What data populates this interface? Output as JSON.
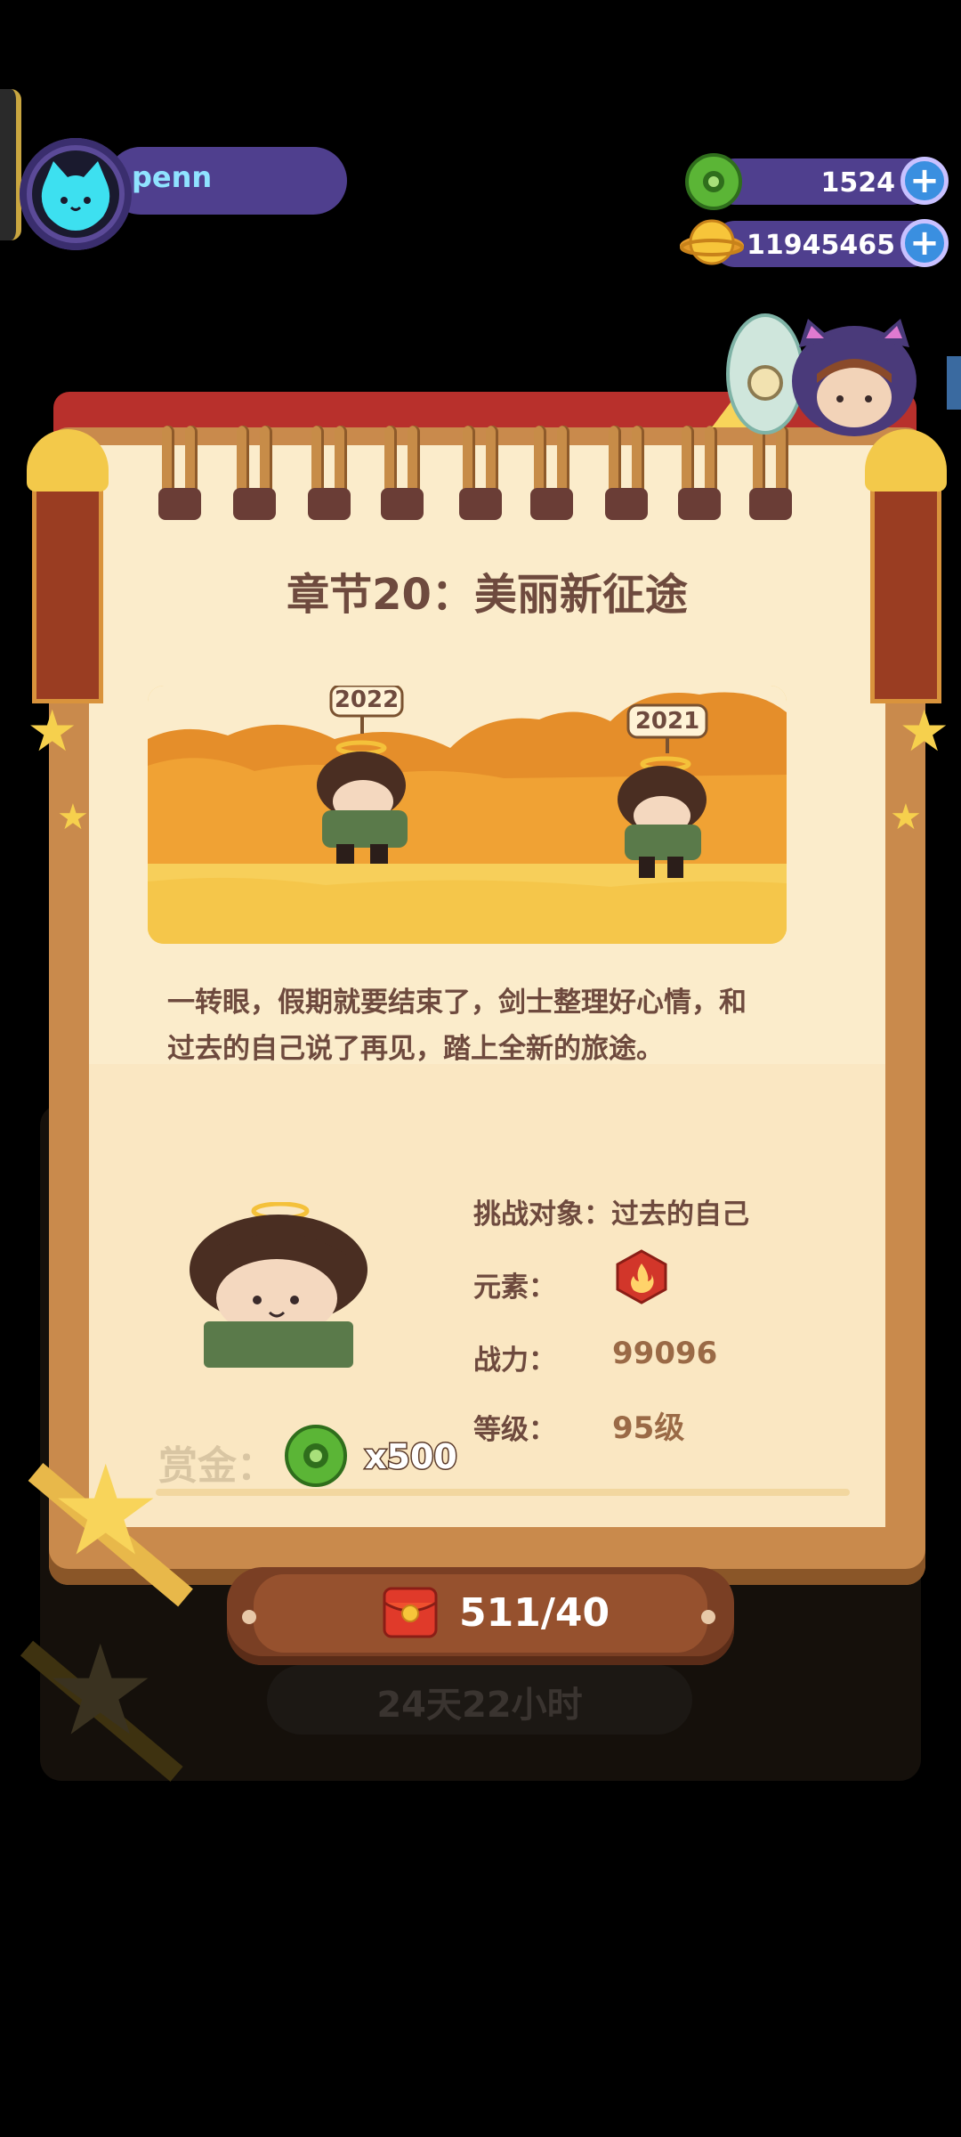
{
  "player": {
    "name": "penn"
  },
  "currency": {
    "gems": "1524",
    "coins": "11945465",
    "plus_symbol": "+"
  },
  "chapter": {
    "title": "章节20：美丽新征途",
    "sign_left": "2022",
    "sign_right": "2021",
    "story_line1": "一转眼，假期就要结束了，剑士整理好心情，和",
    "story_line2": "过去的自己说了再见，踏上全新的旅途。"
  },
  "enemy": {
    "challenge_target": "挑战对象：过去的自己",
    "element_label": "元素：",
    "element_icon": "fire-icon",
    "power_label": "战力：",
    "power_value": "99096",
    "level_label": "等级：",
    "level_value": "95级"
  },
  "reward": {
    "label": "赏金：",
    "amount": "x500"
  },
  "ticket": {
    "count": "511/40"
  },
  "timer": {
    "text": "24天22小时"
  },
  "colors": {
    "panel_purple": "#4f3f8e",
    "page_cream": "#fbeccb",
    "text_brown": "#6e4a3e",
    "accent_orange": "#f4c24c",
    "frame_brown": "#c98a4c"
  }
}
